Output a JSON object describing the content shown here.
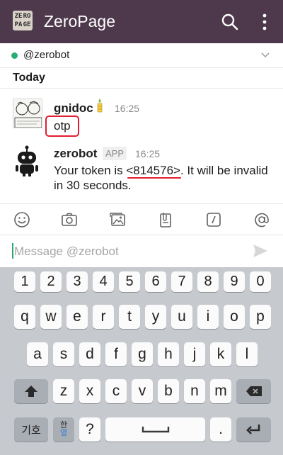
{
  "app": {
    "title": "ZeroPage",
    "logo_letters": [
      "ZE",
      "RO",
      "PA",
      "GE"
    ],
    "brand_color": "#4d394b"
  },
  "channel": {
    "name": "@zerobot",
    "presence_color": "#2bac76"
  },
  "day_divider": "Today",
  "messages": [
    {
      "user": "gnidoc",
      "time": "16:25",
      "text": "otp",
      "status_emoji": "candle-icon"
    },
    {
      "user": "zerobot",
      "badge": "APP",
      "time": "16:25",
      "line1": "Your token is <814576>. It will be invalid",
      "line2": "in 30 seconds."
    }
  ],
  "toolbar": [
    "emoji-icon",
    "camera-icon",
    "photos-icon",
    "file-icon",
    "command-icon",
    "mention-icon"
  ],
  "composer": {
    "placeholder": "Message @zerobot"
  },
  "keyboard": {
    "row_numbers": [
      "1",
      "2",
      "3",
      "4",
      "5",
      "6",
      "7",
      "8",
      "9",
      "0"
    ],
    "row1": [
      "q",
      "w",
      "e",
      "r",
      "t",
      "y",
      "u",
      "i",
      "o",
      "p"
    ],
    "row2": [
      "a",
      "s",
      "d",
      "f",
      "g",
      "h",
      "j",
      "k",
      "l"
    ],
    "row3": [
      "z",
      "x",
      "c",
      "v",
      "b",
      "n",
      "m"
    ],
    "lang_key": "기호",
    "hanyeong_top": "한",
    "hanyeong_bottom": "영",
    "question_key": "?",
    "period_key": "."
  }
}
